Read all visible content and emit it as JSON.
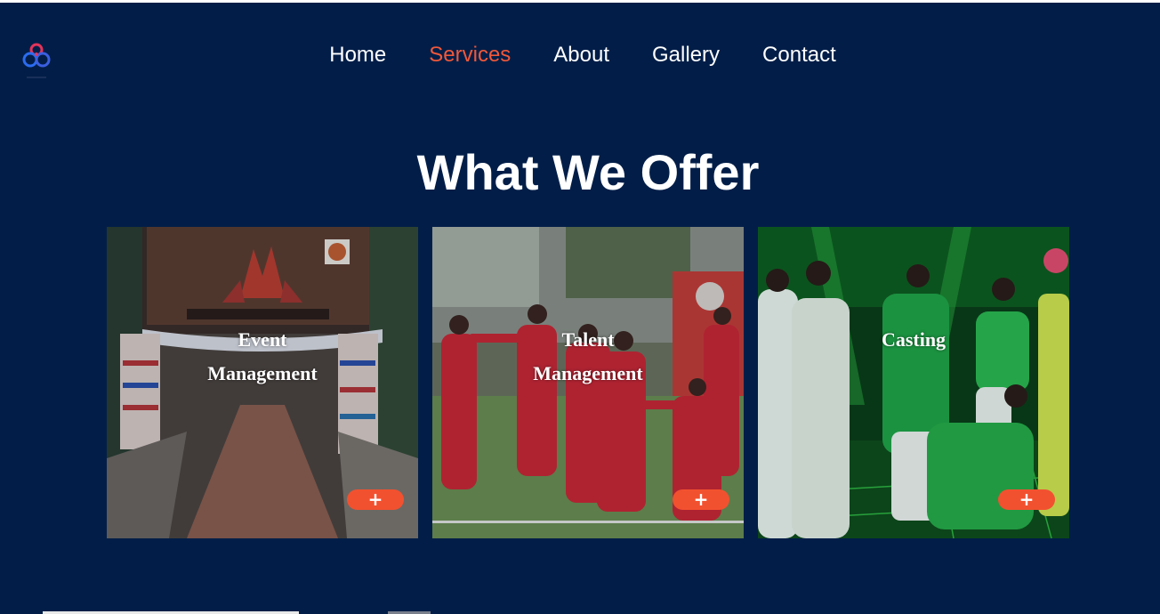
{
  "nav": {
    "items": [
      {
        "label": "Home"
      },
      {
        "label": "Services"
      },
      {
        "label": "About"
      },
      {
        "label": "Gallery"
      },
      {
        "label": "Contact"
      }
    ],
    "active": "Services"
  },
  "section": {
    "heading": "What We Offer"
  },
  "cards": [
    {
      "title_line1": "Event",
      "title_line2": "Management",
      "button": "+"
    },
    {
      "title_line1": "Talent",
      "title_line2": "Management",
      "button": "+"
    },
    {
      "title_line1": "Casting",
      "title_line2": "",
      "button": "+"
    }
  ],
  "colors": {
    "background": "#021e48",
    "accent": "#f0583a",
    "button": "#f2512f",
    "text": "#ffffff"
  },
  "icons": {
    "logo": "interlocking-rings-logo",
    "card_button": "plus-icon"
  }
}
